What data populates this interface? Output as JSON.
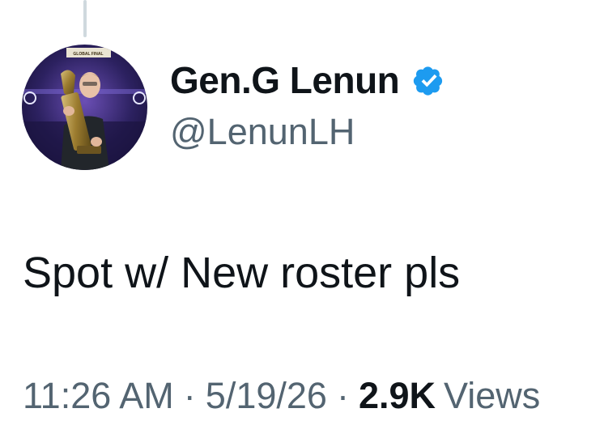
{
  "tweet": {
    "display_name": "Gen.G Lenun",
    "verified": true,
    "handle": "@LenunLH",
    "text": "Spot w/ New roster pls",
    "time": "11:26 AM",
    "date": "5/19/26",
    "separator": "·",
    "views_count": "2.9K",
    "views_label": "Views"
  },
  "avatar": {
    "banner_text": "GLOBAL FINAL"
  },
  "colors": {
    "text_primary": "#0f1419",
    "text_secondary": "#536471",
    "verified_blue": "#1d9bf0",
    "thread_line": "#cfd9de"
  },
  "icons": {
    "verified": "verified-badge-icon"
  }
}
